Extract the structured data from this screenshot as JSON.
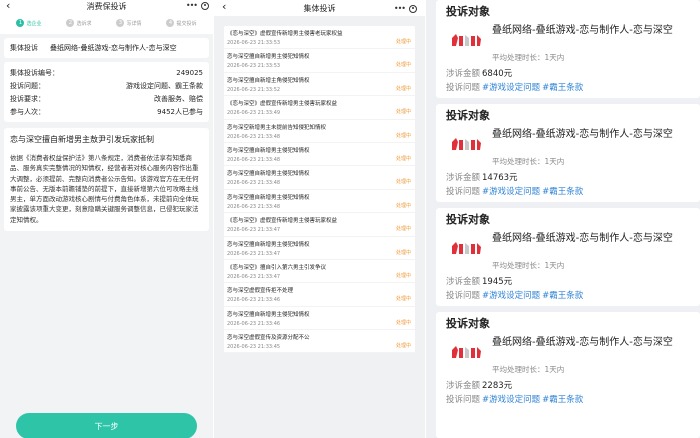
{
  "panel1": {
    "title": "消费保投诉",
    "steps": [
      {
        "num": "1",
        "label": "选企业"
      },
      {
        "num": "2",
        "label": "选诉求"
      },
      {
        "num": "3",
        "label": "写详情"
      },
      {
        "num": "4",
        "label": "提交投诉"
      }
    ],
    "group_label": "集体投诉",
    "group_target": "叠纸网络-叠纸游戏-恋与制作人-恋与深空",
    "info": [
      {
        "k": "集体投诉编号：",
        "v": "249025"
      },
      {
        "k": "投诉问题：",
        "v": "游戏设定问题、霸王条款"
      },
      {
        "k": "投诉要求：",
        "v": "改善服务、赔偿"
      },
      {
        "k": "参与人次：",
        "v": "9452人已参与"
      }
    ],
    "article_title": "恋与深空擅自新增男主敖尹引发玩家抵制",
    "article_body": "依据《消费者权益保护法》第八条规定，消费者依法享有知悉商品、服务真实完整情况的知情权，经营者若对核心服务内容作出重大调整，必须提前、完整向消费者公示告知。该游戏官方在无任何事前公告、无版本前瞻铺垫的前提下，直接新增第六位可攻略主线男主，单方面改动游戏核心剧情与付费角色体系，未提前向全体玩家披露该项重大变更，刻意隐瞒关键服务调整信息，已侵犯玩家法定知情权。",
    "next_button": "下一步"
  },
  "panel2": {
    "title": "集体投诉",
    "items": [
      {
        "title": "《恋与深空》虚假宣传新增男主侵害老玩家权益",
        "date": "2026-06-23 21:33:53",
        "status": "处理中"
      },
      {
        "title": "恋与深空擅自新增男主侵犯知情权",
        "date": "2026-06-23 21:33:53",
        "status": "处理中"
      },
      {
        "title": "恋与深空擅自新增主角侵犯知情权",
        "date": "2026-06-23 21:33:52",
        "status": "处理中"
      },
      {
        "title": "《恋与深空》虚假宣传新增男主侵害玩家权益",
        "date": "2026-06-23 21:33:49",
        "status": "处理中"
      },
      {
        "title": "恋与深空新增男主未提前告知侵犯知情权",
        "date": "2026-06-23 21:33:48",
        "status": "处理中"
      },
      {
        "title": "恋与深空擅自新增男主侵犯知情权",
        "date": "2026-06-23 21:33:48",
        "status": "处理中"
      },
      {
        "title": "恋与深空擅自新增男主侵犯知情权",
        "date": "2026-06-23 21:33:48",
        "status": "处理中"
      },
      {
        "title": "恋与深空擅自新增男主侵犯知情权",
        "date": "2026-06-23 21:33:48",
        "status": "处理中"
      },
      {
        "title": "《恋与深空》虚假宣传新增男主侵害玩家权益",
        "date": "2026-06-23 21:33:47",
        "status": "处理中"
      },
      {
        "title": "恋与深空擅自新增男主侵犯知情权",
        "date": "2026-06-23 21:33:47",
        "status": "处理中"
      },
      {
        "title": "《恋与深空》擅自引入第六男主引发争议",
        "date": "2026-06-23 21:33:47",
        "status": "处理中"
      },
      {
        "title": "恋与深空虚假宣传拒不处理",
        "date": "2026-06-23 21:33:46",
        "status": "处理中"
      },
      {
        "title": "恋与深空擅自新增男主侵犯知情权",
        "date": "2026-06-23 21:33:46",
        "status": "处理中"
      },
      {
        "title": "恋与深空虚假宣传及资源分配不公",
        "date": "2026-06-23 21:33:45",
        "status": "处理中"
      }
    ]
  },
  "panel3": {
    "cards": [
      {
        "heading": "投诉对象",
        "name": "叠纸网络-叠纸游戏-恋与制作人-恋与深空",
        "sub": "平均处理时长：1天内",
        "amount_label": "涉诉金额",
        "amount": "6840元",
        "issue_label": "投诉问题",
        "tags": [
          "#游戏设定问题",
          "#霸王条款"
        ]
      },
      {
        "heading": "投诉对象",
        "name": "叠纸网络-叠纸游戏-恋与制作人-恋与深空",
        "sub": "平均处理时长：1天内",
        "amount_label": "涉诉金额",
        "amount": "14763元",
        "issue_label": "投诉问题",
        "tags": [
          "#游戏设定问题",
          "#霸王条款"
        ]
      },
      {
        "heading": "投诉对象",
        "name": "叠纸网络-叠纸游戏-恋与制作人-恋与深空",
        "sub": "平均处理时长：1天内",
        "amount_label": "涉诉金额",
        "amount": "1945元",
        "issue_label": "投诉问题",
        "tags": [
          "#游戏设定问题",
          "#霸王条款"
        ]
      },
      {
        "heading": "投诉对象",
        "name": "叠纸网络-叠纸游戏-恋与制作人-恋与深空",
        "sub": "平均处理时长：1天内",
        "amount_label": "涉诉金额",
        "amount": "2283元",
        "issue_label": "投诉问题",
        "tags": [
          "#游戏设定问题",
          "#霸王条款"
        ]
      }
    ]
  },
  "colors": {
    "accent": "#2ec4a8",
    "status": "#f29a38",
    "tag": "#2e83d6",
    "logo": "#e0303a"
  }
}
